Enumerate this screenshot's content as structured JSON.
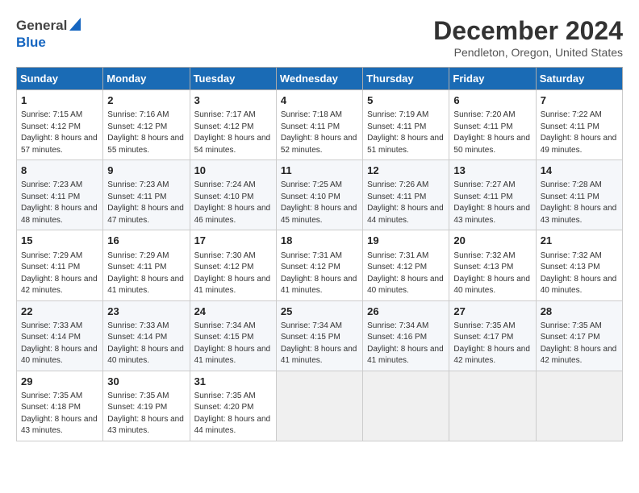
{
  "header": {
    "logo_general": "General",
    "logo_blue": "Blue",
    "month_title": "December 2024",
    "location": "Pendleton, Oregon, United States"
  },
  "days_of_week": [
    "Sunday",
    "Monday",
    "Tuesday",
    "Wednesday",
    "Thursday",
    "Friday",
    "Saturday"
  ],
  "weeks": [
    [
      {
        "day": "1",
        "sunrise": "Sunrise: 7:15 AM",
        "sunset": "Sunset: 4:12 PM",
        "daylight": "Daylight: 8 hours and 57 minutes."
      },
      {
        "day": "2",
        "sunrise": "Sunrise: 7:16 AM",
        "sunset": "Sunset: 4:12 PM",
        "daylight": "Daylight: 8 hours and 55 minutes."
      },
      {
        "day": "3",
        "sunrise": "Sunrise: 7:17 AM",
        "sunset": "Sunset: 4:12 PM",
        "daylight": "Daylight: 8 hours and 54 minutes."
      },
      {
        "day": "4",
        "sunrise": "Sunrise: 7:18 AM",
        "sunset": "Sunset: 4:11 PM",
        "daylight": "Daylight: 8 hours and 52 minutes."
      },
      {
        "day": "5",
        "sunrise": "Sunrise: 7:19 AM",
        "sunset": "Sunset: 4:11 PM",
        "daylight": "Daylight: 8 hours and 51 minutes."
      },
      {
        "day": "6",
        "sunrise": "Sunrise: 7:20 AM",
        "sunset": "Sunset: 4:11 PM",
        "daylight": "Daylight: 8 hours and 50 minutes."
      },
      {
        "day": "7",
        "sunrise": "Sunrise: 7:22 AM",
        "sunset": "Sunset: 4:11 PM",
        "daylight": "Daylight: 8 hours and 49 minutes."
      }
    ],
    [
      {
        "day": "8",
        "sunrise": "Sunrise: 7:23 AM",
        "sunset": "Sunset: 4:11 PM",
        "daylight": "Daylight: 8 hours and 48 minutes."
      },
      {
        "day": "9",
        "sunrise": "Sunrise: 7:23 AM",
        "sunset": "Sunset: 4:11 PM",
        "daylight": "Daylight: 8 hours and 47 minutes."
      },
      {
        "day": "10",
        "sunrise": "Sunrise: 7:24 AM",
        "sunset": "Sunset: 4:10 PM",
        "daylight": "Daylight: 8 hours and 46 minutes."
      },
      {
        "day": "11",
        "sunrise": "Sunrise: 7:25 AM",
        "sunset": "Sunset: 4:10 PM",
        "daylight": "Daylight: 8 hours and 45 minutes."
      },
      {
        "day": "12",
        "sunrise": "Sunrise: 7:26 AM",
        "sunset": "Sunset: 4:11 PM",
        "daylight": "Daylight: 8 hours and 44 minutes."
      },
      {
        "day": "13",
        "sunrise": "Sunrise: 7:27 AM",
        "sunset": "Sunset: 4:11 PM",
        "daylight": "Daylight: 8 hours and 43 minutes."
      },
      {
        "day": "14",
        "sunrise": "Sunrise: 7:28 AM",
        "sunset": "Sunset: 4:11 PM",
        "daylight": "Daylight: 8 hours and 43 minutes."
      }
    ],
    [
      {
        "day": "15",
        "sunrise": "Sunrise: 7:29 AM",
        "sunset": "Sunset: 4:11 PM",
        "daylight": "Daylight: 8 hours and 42 minutes."
      },
      {
        "day": "16",
        "sunrise": "Sunrise: 7:29 AM",
        "sunset": "Sunset: 4:11 PM",
        "daylight": "Daylight: 8 hours and 41 minutes."
      },
      {
        "day": "17",
        "sunrise": "Sunrise: 7:30 AM",
        "sunset": "Sunset: 4:12 PM",
        "daylight": "Daylight: 8 hours and 41 minutes."
      },
      {
        "day": "18",
        "sunrise": "Sunrise: 7:31 AM",
        "sunset": "Sunset: 4:12 PM",
        "daylight": "Daylight: 8 hours and 41 minutes."
      },
      {
        "day": "19",
        "sunrise": "Sunrise: 7:31 AM",
        "sunset": "Sunset: 4:12 PM",
        "daylight": "Daylight: 8 hours and 40 minutes."
      },
      {
        "day": "20",
        "sunrise": "Sunrise: 7:32 AM",
        "sunset": "Sunset: 4:13 PM",
        "daylight": "Daylight: 8 hours and 40 minutes."
      },
      {
        "day": "21",
        "sunrise": "Sunrise: 7:32 AM",
        "sunset": "Sunset: 4:13 PM",
        "daylight": "Daylight: 8 hours and 40 minutes."
      }
    ],
    [
      {
        "day": "22",
        "sunrise": "Sunrise: 7:33 AM",
        "sunset": "Sunset: 4:14 PM",
        "daylight": "Daylight: 8 hours and 40 minutes."
      },
      {
        "day": "23",
        "sunrise": "Sunrise: 7:33 AM",
        "sunset": "Sunset: 4:14 PM",
        "daylight": "Daylight: 8 hours and 40 minutes."
      },
      {
        "day": "24",
        "sunrise": "Sunrise: 7:34 AM",
        "sunset": "Sunset: 4:15 PM",
        "daylight": "Daylight: 8 hours and 41 minutes."
      },
      {
        "day": "25",
        "sunrise": "Sunrise: 7:34 AM",
        "sunset": "Sunset: 4:15 PM",
        "daylight": "Daylight: 8 hours and 41 minutes."
      },
      {
        "day": "26",
        "sunrise": "Sunrise: 7:34 AM",
        "sunset": "Sunset: 4:16 PM",
        "daylight": "Daylight: 8 hours and 41 minutes."
      },
      {
        "day": "27",
        "sunrise": "Sunrise: 7:35 AM",
        "sunset": "Sunset: 4:17 PM",
        "daylight": "Daylight: 8 hours and 42 minutes."
      },
      {
        "day": "28",
        "sunrise": "Sunrise: 7:35 AM",
        "sunset": "Sunset: 4:17 PM",
        "daylight": "Daylight: 8 hours and 42 minutes."
      }
    ],
    [
      {
        "day": "29",
        "sunrise": "Sunrise: 7:35 AM",
        "sunset": "Sunset: 4:18 PM",
        "daylight": "Daylight: 8 hours and 43 minutes."
      },
      {
        "day": "30",
        "sunrise": "Sunrise: 7:35 AM",
        "sunset": "Sunset: 4:19 PM",
        "daylight": "Daylight: 8 hours and 43 minutes."
      },
      {
        "day": "31",
        "sunrise": "Sunrise: 7:35 AM",
        "sunset": "Sunset: 4:20 PM",
        "daylight": "Daylight: 8 hours and 44 minutes."
      },
      null,
      null,
      null,
      null
    ]
  ]
}
